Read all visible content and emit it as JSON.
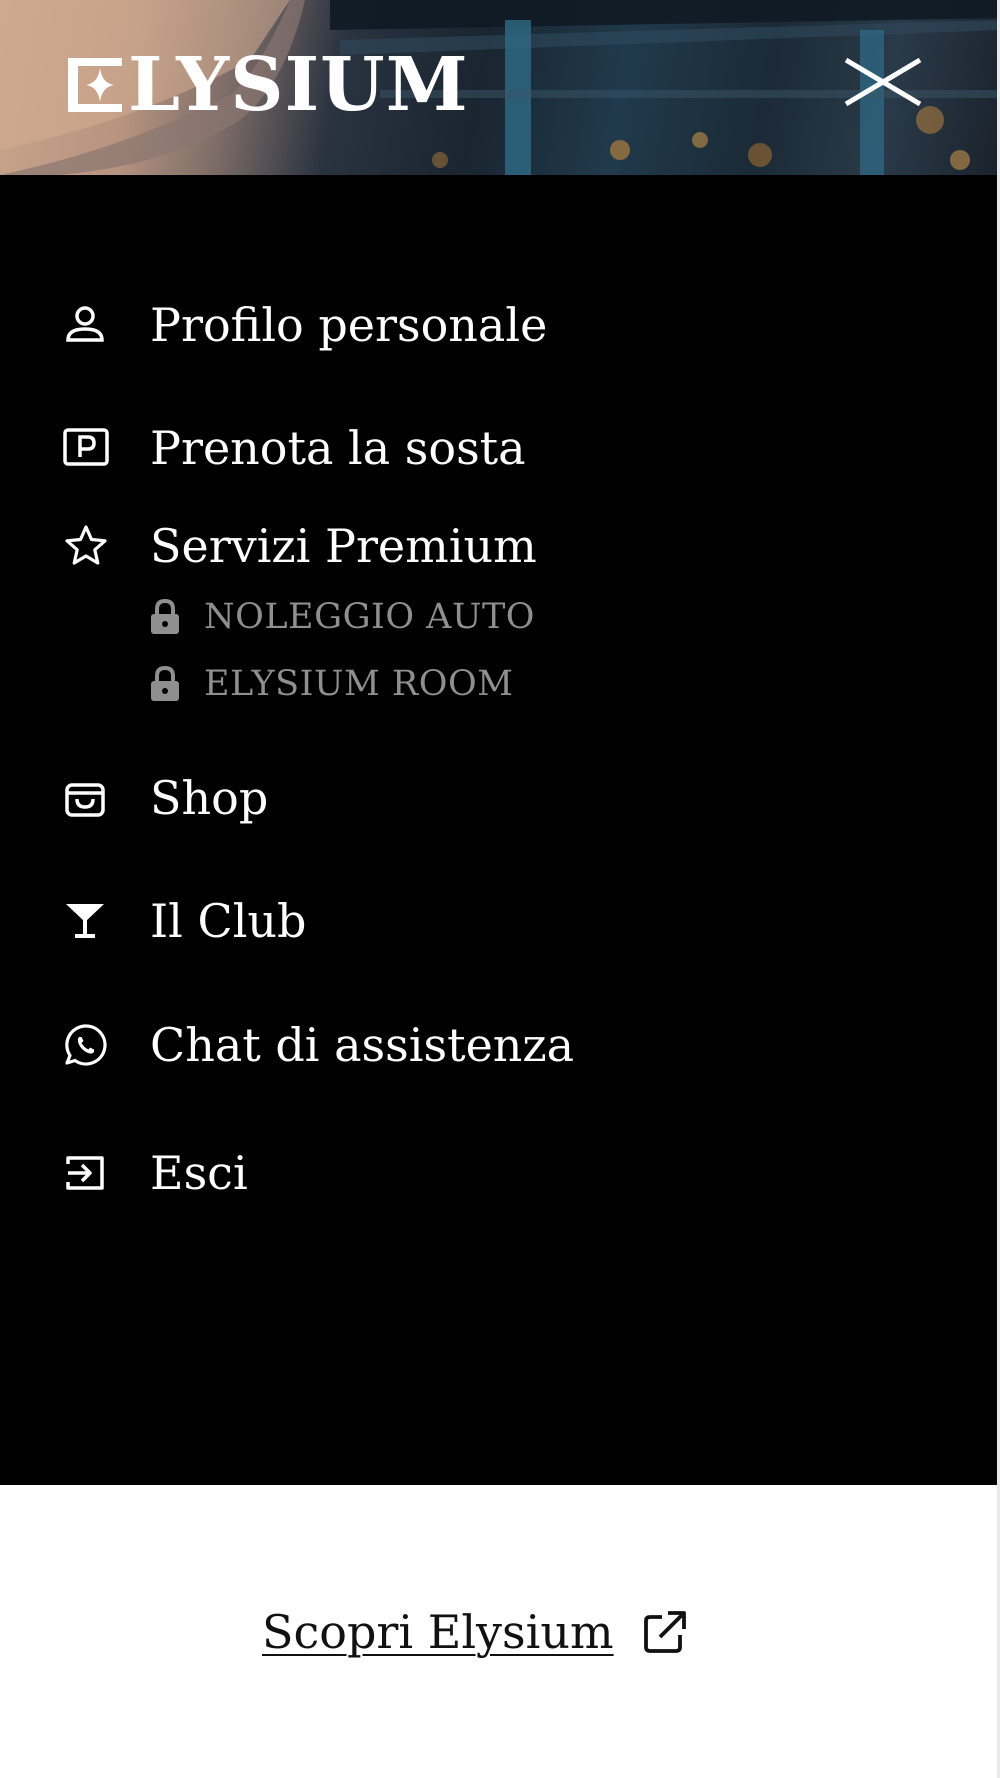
{
  "header": {
    "logo_text": "ELYSIUM",
    "close_icon": "close-icon"
  },
  "menu": {
    "items": [
      {
        "label": "Profilo personale",
        "icon": "person-icon"
      },
      {
        "label": "Prenota la sosta",
        "icon": "parking-icon"
      },
      {
        "label": "Servizi Premium",
        "icon": "star-icon"
      },
      {
        "label": "Shop",
        "icon": "shopping-bag-icon"
      },
      {
        "label": "Il Club",
        "icon": "cocktail-glass-icon"
      },
      {
        "label": "Chat di assistenza",
        "icon": "whatsapp-icon"
      },
      {
        "label": "Esci",
        "icon": "logout-icon"
      }
    ],
    "premium_subitems": [
      {
        "label": "NOLEGGIO AUTO",
        "icon": "lock-icon",
        "locked": true
      },
      {
        "label": "ELYSIUM ROOM",
        "icon": "lock-icon",
        "locked": true
      }
    ]
  },
  "footer": {
    "discover_label": "Scopri Elysium",
    "discover_icon": "external-link-icon"
  },
  "colors": {
    "menu_background": "#000000",
    "menu_text": "#ffffff",
    "locked_text": "#8f8f8f",
    "footer_background": "#ffffff",
    "link_text": "#111111"
  }
}
